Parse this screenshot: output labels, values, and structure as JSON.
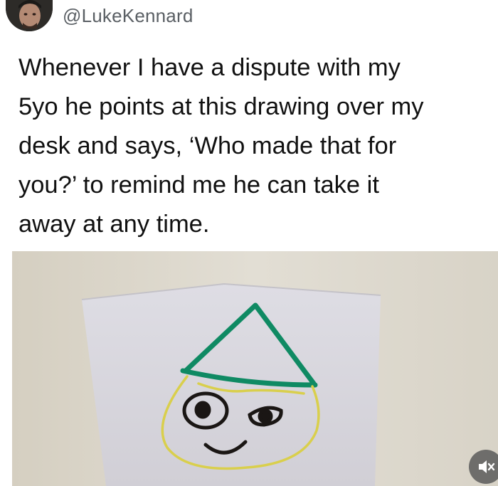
{
  "post": {
    "handle": "@LukeKennard",
    "text": "Whenever I have a dispute with my\n5yo he points at this drawing over my\ndesk and says, ‘Who made that for\nyou?’ to remind me he can take it\naway at any time."
  },
  "media": {
    "mute_icon": "speaker-muted-icon"
  },
  "colors": {
    "hat": "#0f8a63",
    "face": "#d9cf4c",
    "wall": "#dcd7cb"
  }
}
